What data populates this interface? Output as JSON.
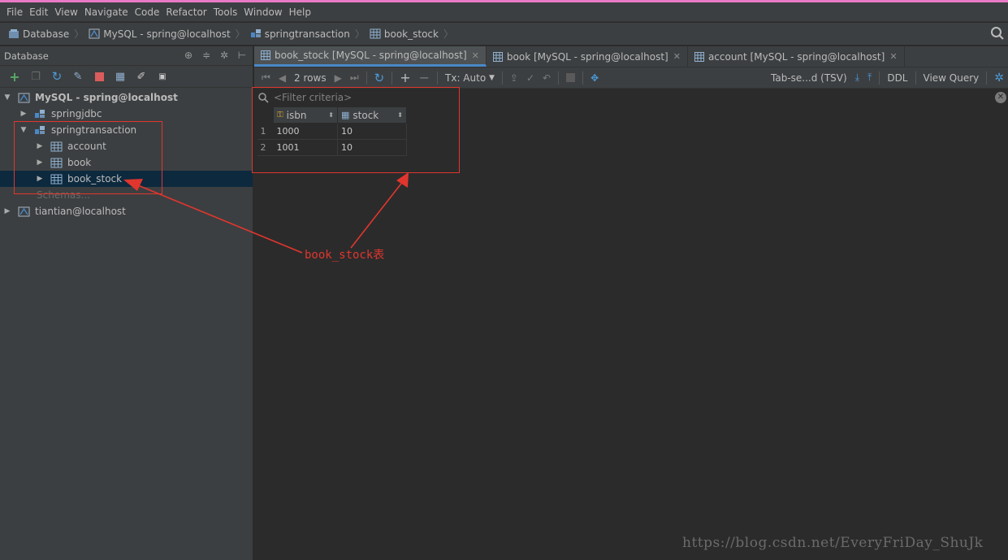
{
  "menu": [
    "File",
    "Edit",
    "View",
    "Navigate",
    "Code",
    "Refactor",
    "Tools",
    "Window",
    "Help"
  ],
  "breadcrumb": [
    "Database",
    "MySQL - spring@localhost",
    "springtransaction",
    "book_stock"
  ],
  "left_panel": {
    "title": "Database",
    "tree": {
      "root": "MySQL - spring@localhost",
      "schema1": "springjdbc",
      "schema2": "springtransaction",
      "tables": [
        "account",
        "book",
        "book_stock"
      ],
      "schemas_link": "Schemas...",
      "root2": "tiantian@localhost"
    }
  },
  "tabs": [
    {
      "label": "book_stock [MySQL - spring@localhost]",
      "active": true
    },
    {
      "label": "book [MySQL - spring@localhost]",
      "active": false
    },
    {
      "label": "account [MySQL - spring@localhost]",
      "active": false
    }
  ],
  "data_toolbar": {
    "rows": "2 rows",
    "tx": "Tx: Auto",
    "export_format": "Tab-se...d (TSV)",
    "ddl": "DDL",
    "view_query": "View Query"
  },
  "filter": {
    "placeholder": "<Filter criteria>"
  },
  "grid": {
    "columns": [
      "isbn",
      "stock"
    ],
    "rows": [
      {
        "num": "1",
        "isbn": "1000",
        "stock": "10"
      },
      {
        "num": "2",
        "isbn": "1001",
        "stock": "10"
      }
    ]
  },
  "annotation": "book_stock表",
  "watermark": "https://blog.csdn.net/EveryFriDay_ShuJk",
  "colors": {
    "accent": "#4a88c7",
    "annotation": "#e0362e",
    "selection": "#0d293e"
  }
}
